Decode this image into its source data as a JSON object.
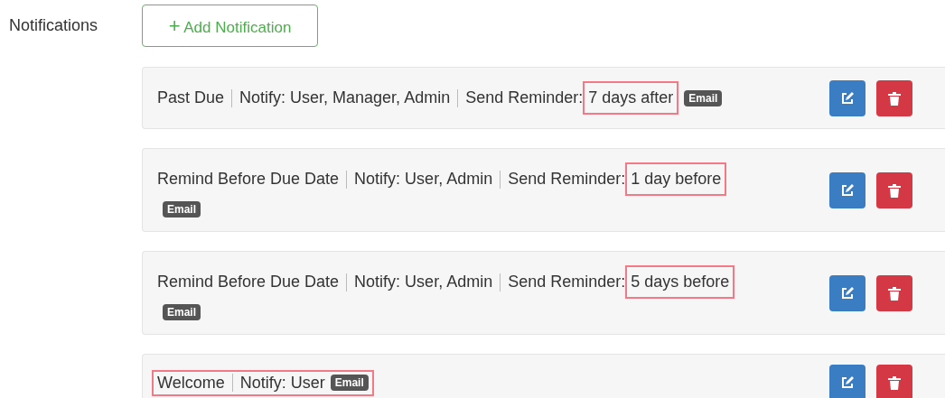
{
  "section_label": "Notifications",
  "add_button": {
    "icon": "+",
    "label": "Add Notification"
  },
  "notifications": [
    {
      "name": "Past Due",
      "notify": "Notify: User, Manager, Admin",
      "reminder_label": "Send Reminder:",
      "reminder_value": "7 days after",
      "tag": "Email",
      "reminder_highlighted": true,
      "highlighted": false
    },
    {
      "name": "Remind Before Due Date",
      "notify": "Notify: User, Admin",
      "reminder_label": "Send Reminder:",
      "reminder_value": "1 day before",
      "tag": "Email",
      "reminder_highlighted": true,
      "highlighted": false
    },
    {
      "name": "Remind Before Due Date",
      "notify": "Notify: User, Admin",
      "reminder_label": "Send Reminder:",
      "reminder_value": "5 days before",
      "tag": "Email",
      "reminder_highlighted": true,
      "highlighted": false
    },
    {
      "name": "Welcome",
      "notify": "Notify: User",
      "tag": "Email",
      "highlighted": true
    }
  ]
}
